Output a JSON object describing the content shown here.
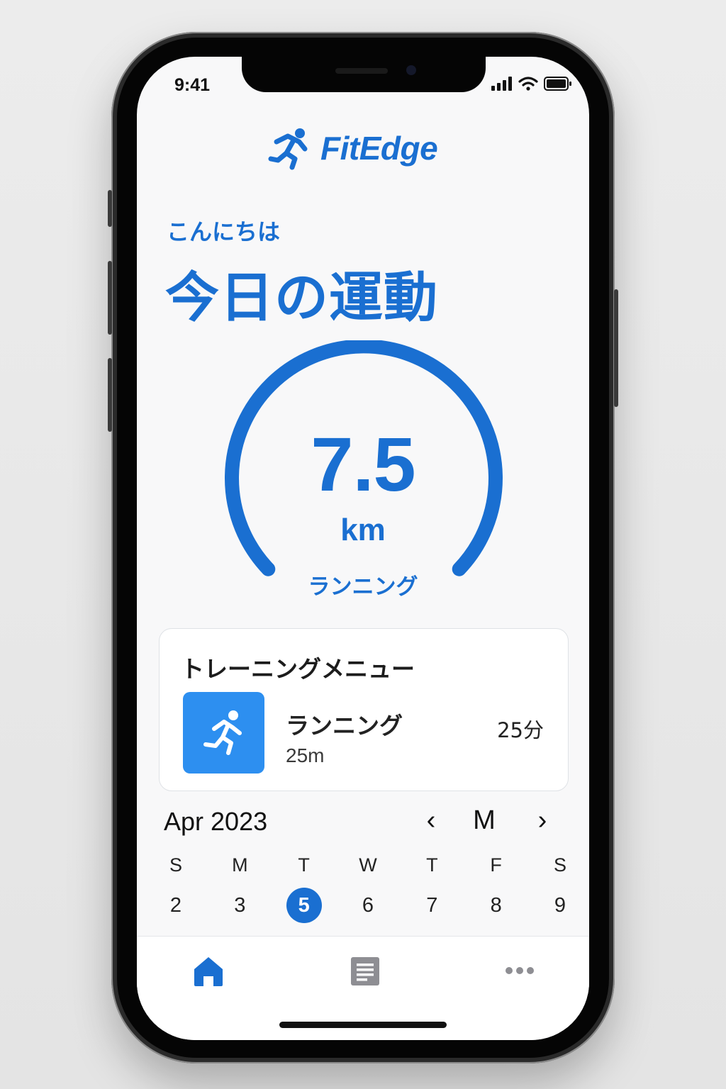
{
  "status_bar": {
    "time": "9:41"
  },
  "brand": {
    "name": "FitEdge",
    "logo_icon": "runner-icon"
  },
  "header": {
    "greeting": "こんにちは",
    "title": "今日の運動"
  },
  "gauge": {
    "value": "7.5",
    "unit": "km",
    "activity": "ランニング",
    "accent": "#1a6fd1"
  },
  "training_menu": {
    "title": "トレーニングメニュー",
    "items": [
      {
        "icon": "runner-icon",
        "name": "ランニング",
        "distance": "25m",
        "duration": "25分"
      }
    ]
  },
  "calendar": {
    "month_label": "Apr 2023",
    "prev": "‹",
    "mode": "M",
    "next": "›",
    "weekdays": [
      "S",
      "M",
      "T",
      "W",
      "T",
      "F",
      "S"
    ],
    "days": [
      "2",
      "3",
      "5",
      "6",
      "7",
      "8",
      "9"
    ],
    "selected_day": "5"
  },
  "tab_bar": {
    "items": [
      "home-icon",
      "document-icon",
      "more-icon"
    ],
    "active": "home-icon"
  }
}
